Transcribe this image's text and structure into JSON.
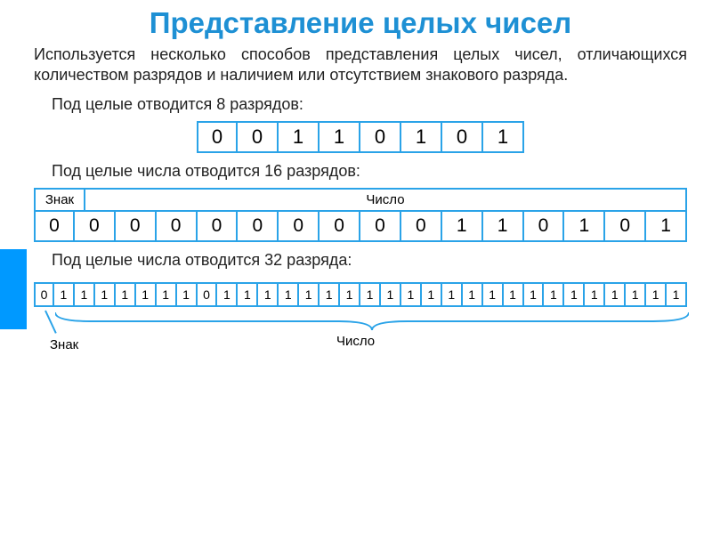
{
  "title": "Представление целых чисел",
  "intro": "Используется несколько способов представления целых чисел, отличающихся количеством разрядов и наличием или отсутствием знакового разряда.",
  "section8": {
    "label": "Под целые отводится 8 разрядов:",
    "bits": [
      "0",
      "0",
      "1",
      "1",
      "0",
      "1",
      "0",
      "1"
    ]
  },
  "section16": {
    "label": "Под целые числа отводится 16 разрядов:",
    "header_sign": "Знак",
    "header_number": "Число",
    "bits": [
      "0",
      "0",
      "0",
      "0",
      "0",
      "0",
      "0",
      "0",
      "0",
      "0",
      "1",
      "1",
      "0",
      "1",
      "0",
      "1"
    ]
  },
  "section32": {
    "label": "Под целые числа отводится 32 разряда:",
    "bits": [
      "0",
      "1",
      "1",
      "1",
      "1",
      "1",
      "1",
      "1",
      "0",
      "1",
      "1",
      "1",
      "1",
      "1",
      "1",
      "1",
      "1",
      "1",
      "1",
      "1",
      "1",
      "1",
      "1",
      "1",
      "1",
      "1",
      "1",
      "1",
      "1",
      "1",
      "1",
      "1"
    ],
    "sign_label": "Знак",
    "number_label": "Число"
  }
}
